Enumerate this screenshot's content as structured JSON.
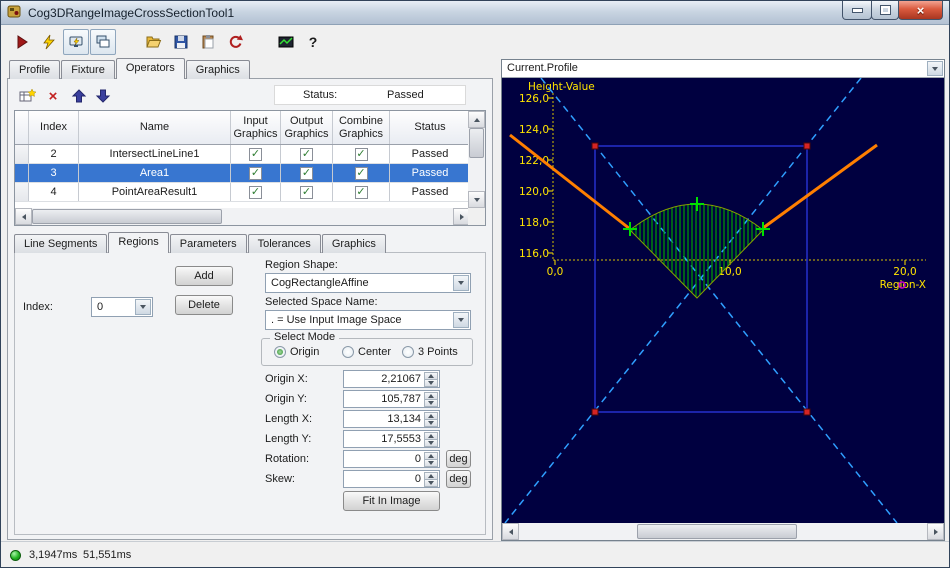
{
  "window": {
    "title": "Cog3DRangeImageCrossSectionTool1"
  },
  "glyphs": {
    "check": "✓",
    "delete_x": "×",
    "close_x": "×"
  },
  "toolbar": {
    "help_glyph": "?"
  },
  "main_tabs": {
    "items": [
      "Profile",
      "Fixture",
      "Operators",
      "Graphics"
    ],
    "active": "Operators"
  },
  "operators_toolbar": {
    "status_label": "Status:",
    "status_value": "Passed"
  },
  "table": {
    "headers": {
      "index": "Index",
      "name": "Name",
      "input": "Input Graphics",
      "output": "Output Graphics",
      "combine": "Combine Graphics",
      "status": "Status"
    },
    "rows": [
      {
        "index": "2",
        "name": "IntersectLineLine1",
        "input_graphics": true,
        "output_graphics": true,
        "combine_graphics": true,
        "status": "Passed",
        "selected": false
      },
      {
        "index": "3",
        "name": "Area1",
        "input_graphics": true,
        "output_graphics": true,
        "combine_graphics": true,
        "status": "Passed",
        "selected": true
      },
      {
        "index": "4",
        "name": "PointAreaResult1",
        "input_graphics": true,
        "output_graphics": true,
        "combine_graphics": true,
        "status": "Passed",
        "selected": false
      }
    ]
  },
  "sub_tabs": {
    "items": [
      "Line Segments",
      "Regions",
      "Parameters",
      "Tolerances",
      "Graphics"
    ],
    "active": "Regions"
  },
  "regions": {
    "index_label": "Index:",
    "index_value": "0",
    "add_button": "Add",
    "delete_button": "Delete",
    "region_shape_label": "Region Shape:",
    "region_shape_value": "CogRectangleAffine",
    "space_name_label": "Selected Space Name:",
    "space_name_value": ". = Use Input Image Space",
    "select_mode_label": "Select Mode",
    "mode_options": [
      "Origin",
      "Center",
      "3 Points"
    ],
    "selected_mode": "Origin",
    "fields": [
      {
        "label": "Origin X:",
        "value": "2,21067"
      },
      {
        "label": "Origin Y:",
        "value": "105,787"
      },
      {
        "label": "Length X:",
        "value": "13,134"
      },
      {
        "label": "Length Y:",
        "value": "17,5553"
      },
      {
        "label": "Rotation:",
        "value": "0",
        "unit": "deg"
      },
      {
        "label": "Skew:",
        "value": "0",
        "unit": "deg"
      }
    ],
    "fit_button": "Fit In Image"
  },
  "profile_view": {
    "selector_value": "Current.Profile",
    "y_axis_title": "Height-Value",
    "x_axis_title": "Region-X",
    "y_ticks": [
      "126,0",
      "124,0",
      "122,0",
      "120,0",
      "118,0",
      "116,0"
    ],
    "x_ticks": [
      "0,0",
      "10,0",
      "20,0"
    ]
  },
  "status_bar": {
    "execution_time": "3,1947ms",
    "total_time": "51,551ms"
  }
}
